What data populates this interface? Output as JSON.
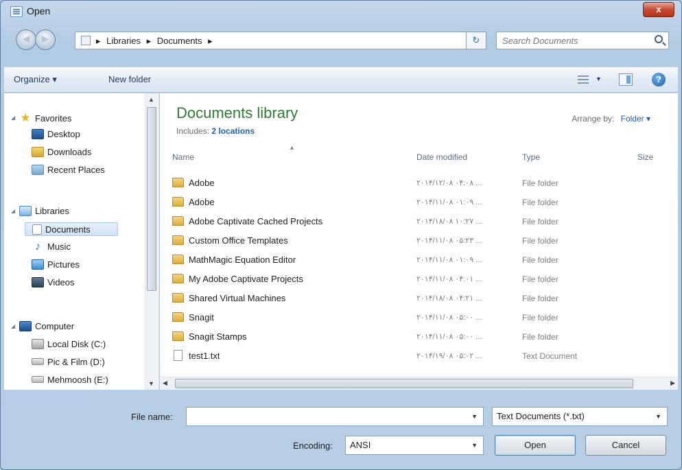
{
  "window": {
    "title": "Open",
    "close_label": "x"
  },
  "address": {
    "crumbs": [
      "Libraries",
      "Documents"
    ],
    "search_placeholder": "Search Documents"
  },
  "toolbar": {
    "organize": "Organize ▾",
    "new_folder": "New folder"
  },
  "nav": {
    "items": [
      {
        "label": "Favorites",
        "icon": "star-icon"
      },
      {
        "label": "Desktop",
        "icon": "desktop-icon"
      },
      {
        "label": "Downloads",
        "icon": "downloads-icon"
      },
      {
        "label": "Recent Places",
        "icon": "recent-places-icon"
      },
      {
        "label": "Libraries",
        "icon": "libraries-icon"
      },
      {
        "label": "Documents",
        "icon": "documents-icon"
      },
      {
        "label": "Music",
        "icon": "music-icon"
      },
      {
        "label": "Pictures",
        "icon": "pictures-icon"
      },
      {
        "label": "Videos",
        "icon": "videos-icon"
      },
      {
        "label": "Computer",
        "icon": "computer-icon"
      },
      {
        "label": "Local Disk (C:)",
        "icon": "disk-icon"
      },
      {
        "label": "Pic & Film (D:)",
        "icon": "disk-icon"
      },
      {
        "label": "Mehmoosh (E:)",
        "icon": "disk-icon"
      }
    ],
    "selected": "Documents"
  },
  "library": {
    "title": "Documents library",
    "includes_label": "Includes:",
    "includes_link": "2 locations",
    "arrange_label": "Arrange by:",
    "arrange_value": "Folder ▾"
  },
  "columns": {
    "name": "Name",
    "date": "Date modified",
    "type": "Type",
    "size": "Size"
  },
  "files": [
    {
      "name": "Adobe",
      "date": "۲۰۱۴/۱۲/۰۸ ۰۴:۰۸ ...",
      "type": "File folder",
      "icon": "folder-icon"
    },
    {
      "name": "Adobe",
      "date": "۲۰۱۴/۱۱/۰۸ ۰۱:۰۹ ...",
      "type": "File folder",
      "icon": "folder-icon"
    },
    {
      "name": "Adobe Captivate Cached Projects",
      "date": "۲۰۱۴/۱۸/۰۸ ۱۰:۲۷ ...",
      "type": "File folder",
      "icon": "folder-icon"
    },
    {
      "name": "Custom Office Templates",
      "date": "۲۰۱۴/۱۱/۰۸ ۰۵:۲۳ ...",
      "type": "File folder",
      "icon": "folder-icon"
    },
    {
      "name": "MathMagic Equation Editor",
      "date": "۲۰۱۴/۱۱/۰۸ ۰۱:۰۹ ...",
      "type": "File folder",
      "icon": "folder-icon"
    },
    {
      "name": "My Adobe Captivate Projects",
      "date": "۲۰۱۴/۱۱/۰۸ ۰۴:۰۱ ...",
      "type": "File folder",
      "icon": "folder-icon"
    },
    {
      "name": "Shared Virtual Machines",
      "date": "۲۰۱۴/۱۸/۰۸ ۰۴:۲۱ ...",
      "type": "File folder",
      "icon": "folder-icon"
    },
    {
      "name": "Snagit",
      "date": "۲۰۱۴/۱۱/۰۸ ۰۵:۰۰ ...",
      "type": "File folder",
      "icon": "folder-icon"
    },
    {
      "name": "Snagit Stamps",
      "date": "۲۰۱۴/۱۱/۰۸ ۰۵:۰۰ ...",
      "type": "File folder",
      "icon": "folder-icon"
    },
    {
      "name": "test1.txt",
      "date": "۲۰۱۴/۱۹/۰۸ ۰۵:۰۲ ...",
      "type": "Text Document",
      "icon": "text-file-icon"
    }
  ],
  "bottom": {
    "file_name_label": "File name:",
    "file_name_value": "",
    "file_type": "Text Documents (*.txt)",
    "encoding_label": "Encoding:",
    "encoding_value": "ANSI",
    "open": "Open",
    "cancel": "Cancel"
  }
}
